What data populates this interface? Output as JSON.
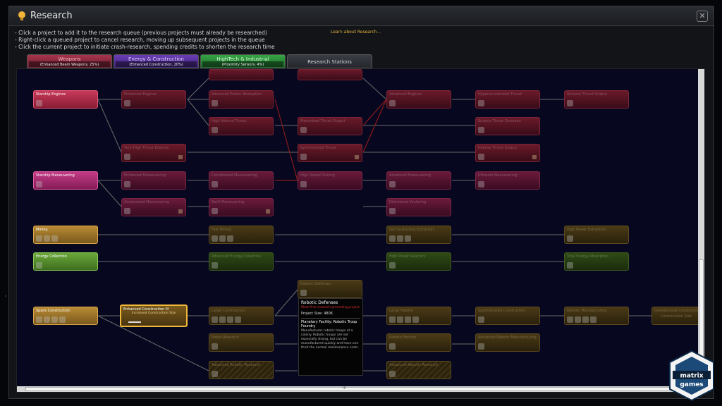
{
  "window": {
    "title": "Research"
  },
  "instructions": [
    "- Click a project to add it to the research queue (previous projects must already be researched)",
    "- Right-click a queued project to cancel research, moving up subsequent projects in the queue",
    "- Click the current project to initiate crash-research, spending credits to shorten the research time"
  ],
  "learn_link": "Learn about Research...",
  "tabs": [
    {
      "label": "Weapons",
      "sub": "(Enhanced Beam Weapons, 25%)"
    },
    {
      "label": "Energy & Construction",
      "sub": "(Enhanced Construction, 20%)"
    },
    {
      "label": "HighTech & Industrial",
      "sub": "(Proximity Sensors, 4%)"
    },
    {
      "label": "Research Stations",
      "sub": ""
    }
  ],
  "nodes": {
    "starship_engines": "Starship Engines",
    "enhanced_engines": "Enhanced Engines",
    "advanced_proton": "Advanced Proton Absorption",
    "advanced_engines": "Advanced Engines",
    "hyperaccel_thrust": "Hyperaccelerated Thrust",
    "reverse_thrust": "Reverse Thrust Output",
    "high_volume_thrust": "High Volume Thrust",
    "maximized_thrust": "Maximized Thrust Output",
    "surplus_thrust": "Surplus Thrust Overload",
    "very_high_thrust": "Very High Thrust Engines",
    "synchronized_thrust": "Synchronized Thrust",
    "intense_thrust": "Intense Thrust Output",
    "starship_maneuvering": "Starship Maneuvering",
    "enhanced_maneuvering": "Enhanced Maneuvering",
    "coordinated_maneuvering": "Coordinated Maneuvering",
    "high_speed_turning": "High Speed Turning",
    "advanced_maneuvering": "Advanced Maneuvering",
    "ultimate_maneuvering": "Ultimate Maneuvering",
    "accelerated_maneuvering": "Accelerated Maneuvering",
    "swift_maneuvering": "Swift Maneuvering",
    "directional_vectoring": "Directional Vectoring",
    "mining": "Mining",
    "fast_mining": "Fast Mining",
    "self_sustaining_extractors": "Self Sustaining Extractors",
    "high_power_extractors": "High Power Extractors",
    "energy_collection": "Energy Collection",
    "advanced_energy_collection": "Advanced Energy Collection",
    "high_power_reactors": "High Power Reactors",
    "total_energy_absorption": "Total Energy Absorption",
    "space_construction": "Space Construction",
    "enhanced_construction": "Enhanced Construction III",
    "enhanced_construction_sub": "Increased Construction Size",
    "robotic_defenses_top": "Robotic Defenses",
    "large_habitat": "Large Habitat",
    "large_construction": "Large Construction",
    "sophisticated_construction": "Sophisticated Construction",
    "gravitational_construction": "Gravitational Construction",
    "gravitational_construction_sub": "Construction Size",
    "robotic_manuf": "Robotic Manufacturing",
    "advanced_robotic": "Advanced Robotic Manufacturing",
    "robotic_factory": "Robotic Factory",
    "advanced_robotic_research": "Advanced Robotic Research",
    "robot_research": "Robot Research"
  },
  "tooltip": {
    "title": "Robotic Defenses",
    "warning": "Must first research preceding project",
    "size": "Project Size: 480K",
    "facility": "Planetary Facility: Robotic Troop Foundry",
    "desc": "Manufactures robotic troops at a colony. Robotic troops are not especially strong, but can be manufactured quickly and have one third the normal maintenance costs."
  },
  "logo": {
    "line1": "matrix",
    "line2": "games"
  },
  "scrollbar": {
    "grip": "III"
  },
  "colors": {
    "weapons": "#a7354c",
    "energy": "#6a3eb6",
    "hightech": "#35a545",
    "selection": "#f0b93a",
    "warning": "#e03030"
  }
}
